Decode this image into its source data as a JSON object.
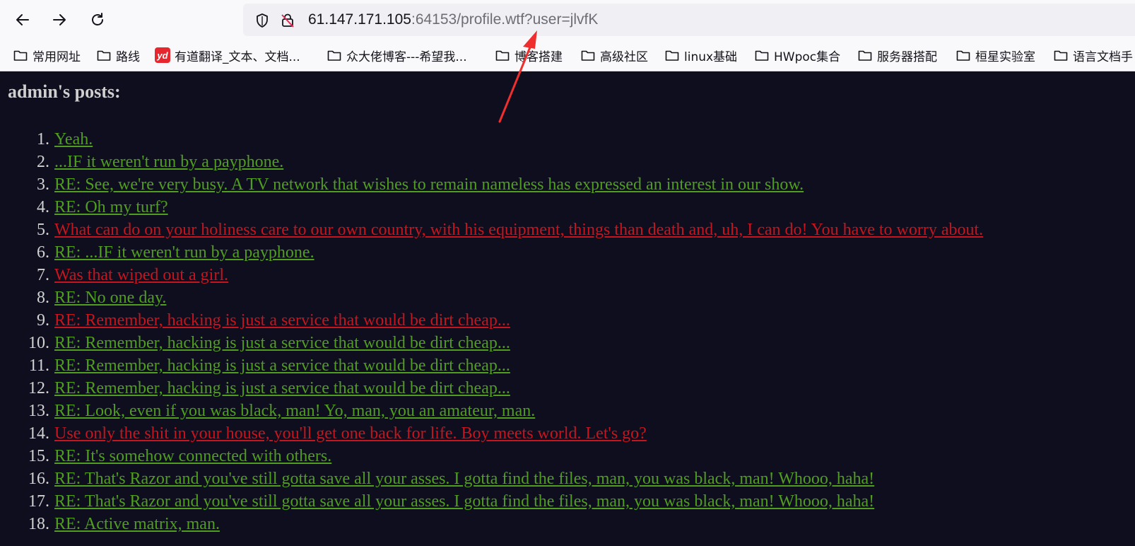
{
  "browser": {
    "url_host": "61.147.171.105",
    "url_rest": ":64153/profile.wtf?user=jlvfK"
  },
  "bookmarks": [
    {
      "label": "常用网址",
      "icon": "folder-icon"
    },
    {
      "label": "路线",
      "icon": "folder-icon"
    },
    {
      "label": "有道翻译_文本、文档...",
      "icon": "youdao-icon"
    },
    {
      "label": "众大佬博客---希望我...",
      "icon": "folder-icon"
    },
    {
      "label": "博客搭建",
      "icon": "folder-icon"
    },
    {
      "label": "高级社区",
      "icon": "folder-icon"
    },
    {
      "label": "linux基础",
      "icon": "folder-icon"
    },
    {
      "label": "HWpoc集合",
      "icon": "folder-icon"
    },
    {
      "label": "服务器搭配",
      "icon": "folder-icon"
    },
    {
      "label": "桓星实验室",
      "icon": "folder-icon"
    },
    {
      "label": "语言文档手",
      "icon": "folder-icon"
    }
  ],
  "page": {
    "title": "admin's posts:"
  },
  "colors": {
    "green": "#4f9e1f",
    "red": "#c8141c"
  },
  "posts": [
    {
      "num": "1.",
      "title": "Yeah.",
      "color": "green"
    },
    {
      "num": "2.",
      "title": "...IF it weren't run by a payphone.",
      "color": "green"
    },
    {
      "num": "3.",
      "title": "RE: See, we're very busy. A TV network that wishes to remain nameless has expressed an interest in our show.",
      "color": "green"
    },
    {
      "num": "4.",
      "title": "RE: Oh my turf?",
      "color": "green"
    },
    {
      "num": "5.",
      "title": "What can do on your holiness care to our own country, with his equipment, things than death and, uh, I can do! You have to worry about.",
      "color": "red"
    },
    {
      "num": "6.",
      "title": "RE: ...IF it weren't run by a payphone.",
      "color": "green"
    },
    {
      "num": "7.",
      "title": "Was that wiped out a girl.",
      "color": "red"
    },
    {
      "num": "8.",
      "title": "RE: No one day.",
      "color": "green"
    },
    {
      "num": "9.",
      "title": "RE: Remember, hacking is just a service that would be dirt cheap...",
      "color": "red"
    },
    {
      "num": "10.",
      "title": "RE: Remember, hacking is just a service that would be dirt cheap...",
      "color": "green"
    },
    {
      "num": "11.",
      "title": "RE: Remember, hacking is just a service that would be dirt cheap...",
      "color": "green"
    },
    {
      "num": "12.",
      "title": "RE: Remember, hacking is just a service that would be dirt cheap...",
      "color": "green"
    },
    {
      "num": "13.",
      "title": "RE: Look, even if you was black, man! Yo, man, you an amateur, man.",
      "color": "green"
    },
    {
      "num": "14.",
      "title": "Use only the shit in your house, you'll get one back for life. Boy meets world. Let's go?",
      "color": "red"
    },
    {
      "num": "15.",
      "title": "RE: It's somehow connected with others.",
      "color": "green"
    },
    {
      "num": "16.",
      "title": "RE: That's Razor and you've still gotta save all your asses. I gotta find the files, man, you was black, man! Whooo, haha!",
      "color": "green"
    },
    {
      "num": "17.",
      "title": "RE: That's Razor and you've still gotta save all your asses. I gotta find the files, man, you was black, man! Whooo, haha!",
      "color": "green"
    },
    {
      "num": "18.",
      "title": "RE: Active matrix, man.",
      "color": "green"
    }
  ]
}
